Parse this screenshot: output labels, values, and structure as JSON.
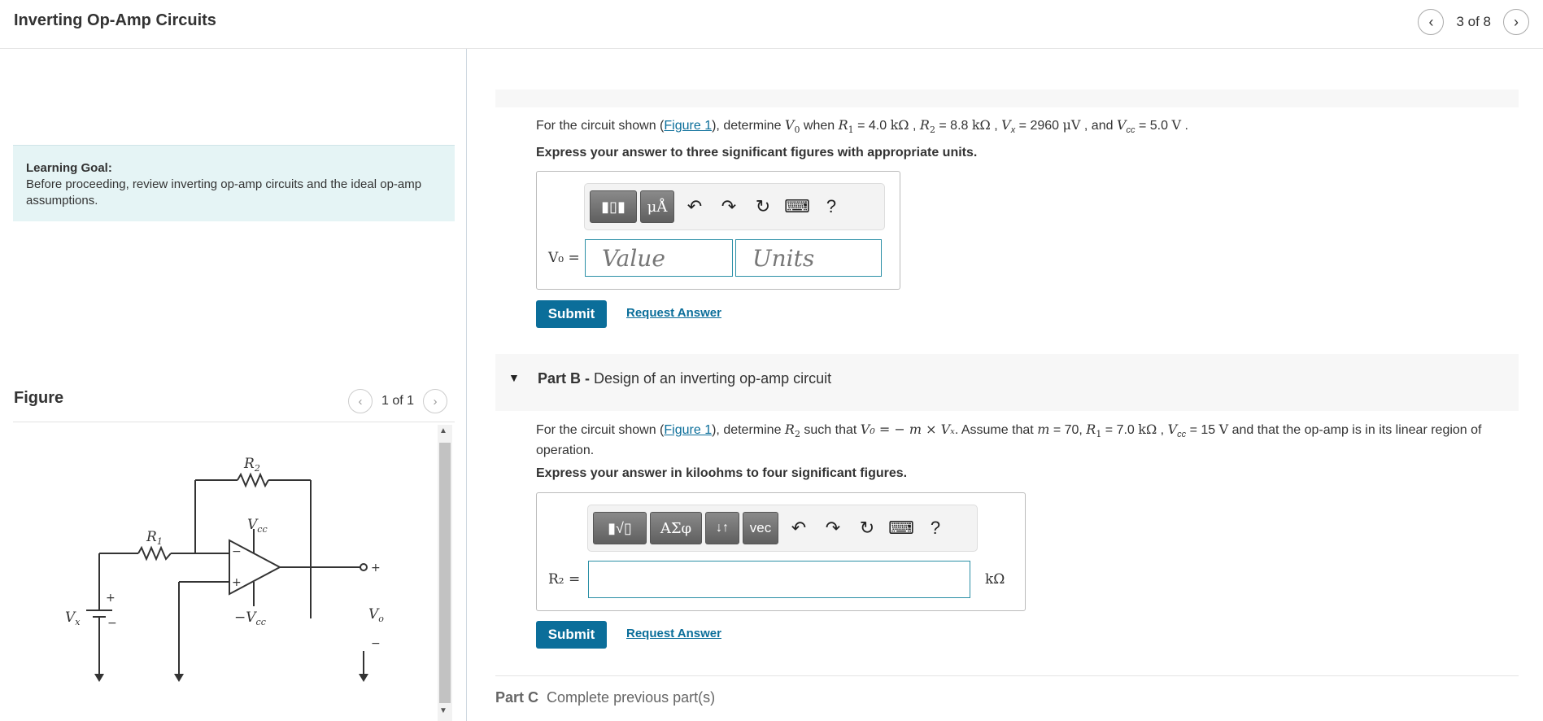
{
  "header": {
    "title": "Inverting Op-Amp Circuits",
    "pager": "3 of 8"
  },
  "learning_goal": {
    "title": "Learning Goal:",
    "text": "Before proceeding, review inverting op-amp circuits and the ideal op-amp assumptions."
  },
  "figure": {
    "title": "Figure",
    "pager": "1 of 1",
    "labels": {
      "r1": "R",
      "r1_sub": "1",
      "r2": "R",
      "r2_sub": "2",
      "vcc": "V",
      "vcc_sub": "cc",
      "nvcc": "−V",
      "nvcc_sub": "cc",
      "vx": "V",
      "vx_sub": "x",
      "vo": "V",
      "vo_sub": "o",
      "plus": "+",
      "minus": "−",
      "opplus": "+",
      "opminus": "−",
      "outplus": "+",
      "outminus": "−"
    }
  },
  "part_a": {
    "q_prefix": "For the circuit shown (",
    "q_link": "Figure 1",
    "q_mid": "), determine ",
    "q_vo": "V",
    "q_vo_sub": "0",
    "q_when": " when ",
    "q_r1": "R",
    "q_r1_sub": "1",
    "q_r1_val": " = 4.0 ",
    "q_r1_unit": "kΩ",
    "q_r2": "R",
    "q_r2_sub": "2",
    "q_r2_val": " = 8.8 ",
    "q_r2_unit": "kΩ",
    "q_vx": "V",
    "q_vx_sub": "x",
    "q_vx_val": " = 2960 ",
    "q_vx_unit": "μV",
    "q_and": " , and ",
    "q_vcc": "V",
    "q_vcc_sub": "cc",
    "q_vcc_val": " = 5.0 ",
    "q_vcc_unit": "V",
    "q_end": " .",
    "instruction": "Express your answer to three significant figures with appropriate units.",
    "var_label": "V₀ =",
    "value_placeholder": "Value",
    "units_placeholder": "Units",
    "toolbar": {
      "mu_a": "μÅ",
      "help": "?"
    },
    "submit": "Submit",
    "request": "Request Answer"
  },
  "part_b": {
    "title_bold": "Part B -",
    "title": " Design of an inverting op-amp circuit",
    "q_prefix": "For the circuit shown (",
    "q_link": "Figure 1",
    "q_mid": "), determine ",
    "q_r2": "R",
    "q_r2_sub": "2",
    "q_such": " such that ",
    "q_eq": "V₀ = − m × Vₓ",
    "q_assume": ". Assume that ",
    "q_m": "m",
    "q_m_val": " = 70, ",
    "q_r1": "R",
    "q_r1_sub": "1",
    "q_r1_val": " = 7.0 ",
    "q_r1_unit": "kΩ",
    "q_vcc": "V",
    "q_vcc_sub": "cc",
    "q_vcc_val": " = 15 ",
    "q_vcc_unit": "V",
    "q_end": " and that the op-amp is in its linear region of operation.",
    "instruction": "Express your answer in kiloohms to four significant figures.",
    "var_label": "R₂ =",
    "unit": "kΩ",
    "toolbar": {
      "greek": "ΑΣφ",
      "arrows": "↓↑",
      "vec": "vec",
      "help": "?"
    },
    "submit": "Submit",
    "request": "Request Answer"
  },
  "part_c": {
    "label": "Part C",
    "text": "Complete previous part(s)"
  }
}
